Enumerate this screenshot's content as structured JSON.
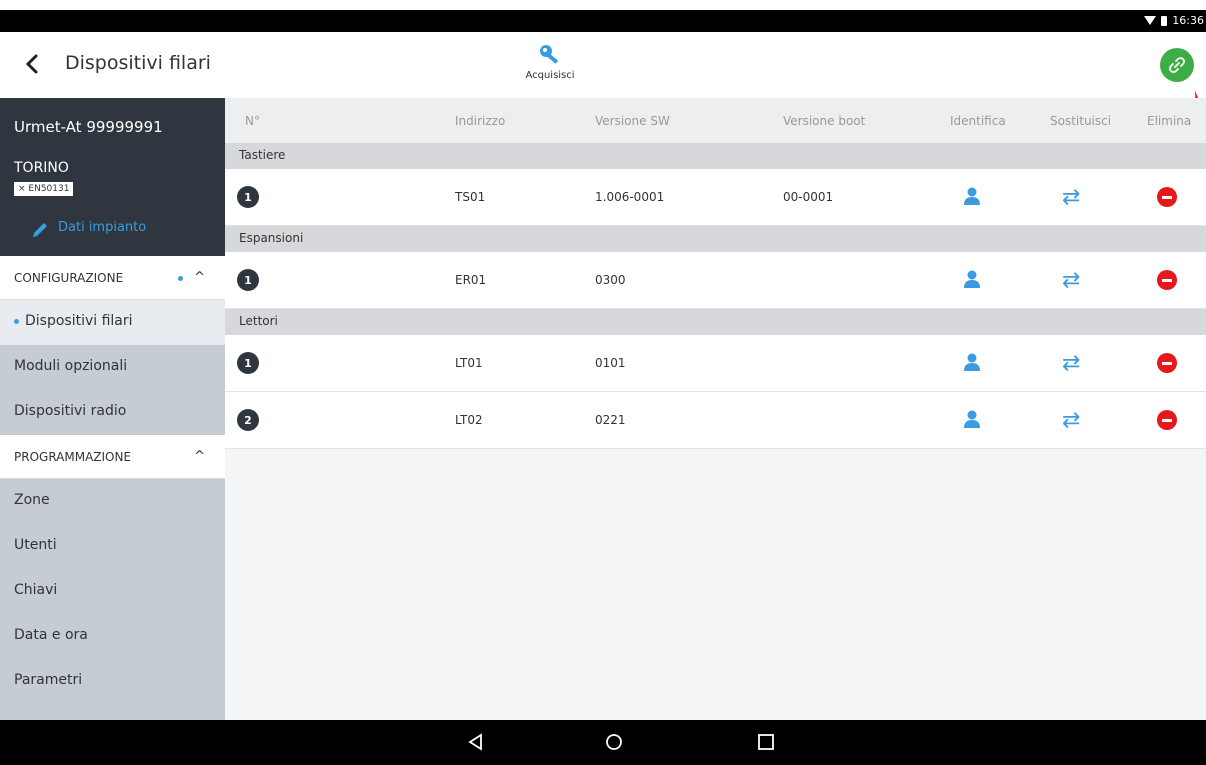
{
  "status": {
    "time": "16:36"
  },
  "appbar": {
    "title": "Dispositivi filari",
    "acquire_label": "Acquisisci"
  },
  "sidebar": {
    "account": "Urmet-At 99999991",
    "city": "TORINO",
    "badge": "× EN50131",
    "dati_label": "Dati impianto",
    "section1": "CONFIGURAZIONE",
    "section1_items": [
      "Dispositivi filari",
      "Moduli opzionali",
      "Dispositivi radio"
    ],
    "section2": "PROGRAMMAZIONE",
    "section2_items": [
      "Zone",
      "Utenti",
      "Chiavi",
      "Data e ora",
      "Parametri"
    ]
  },
  "table": {
    "headers": {
      "no": "N°",
      "address": "Indirizzo",
      "sw": "Versione SW",
      "boot": "Versione boot",
      "identify": "Identifica",
      "replace": "Sostituisci",
      "delete": "Elimina"
    },
    "groups": [
      {
        "label": "Tastiere",
        "rows": [
          {
            "n": "1",
            "address": "TS01",
            "sw": "1.006-0001",
            "boot": "00-0001"
          }
        ]
      },
      {
        "label": "Espansioni",
        "rows": [
          {
            "n": "1",
            "address": "ER01",
            "sw": "0300",
            "boot": ""
          }
        ]
      },
      {
        "label": "Lettori",
        "rows": [
          {
            "n": "1",
            "address": "LT01",
            "sw": "0101",
            "boot": ""
          },
          {
            "n": "2",
            "address": "LT02",
            "sw": "0221",
            "boot": ""
          }
        ]
      }
    ]
  },
  "icons": {
    "back": "chevron-left-icon",
    "acquire": "key-icon",
    "link": "link-icon",
    "identify": "person-icon",
    "replace": "swap-arrows-icon",
    "delete": "minus-circle-icon"
  },
  "colors": {
    "accent": "#3b9be0",
    "link_button": "#3fad46",
    "delete": "#e8171c",
    "dark": "#2f3640"
  }
}
